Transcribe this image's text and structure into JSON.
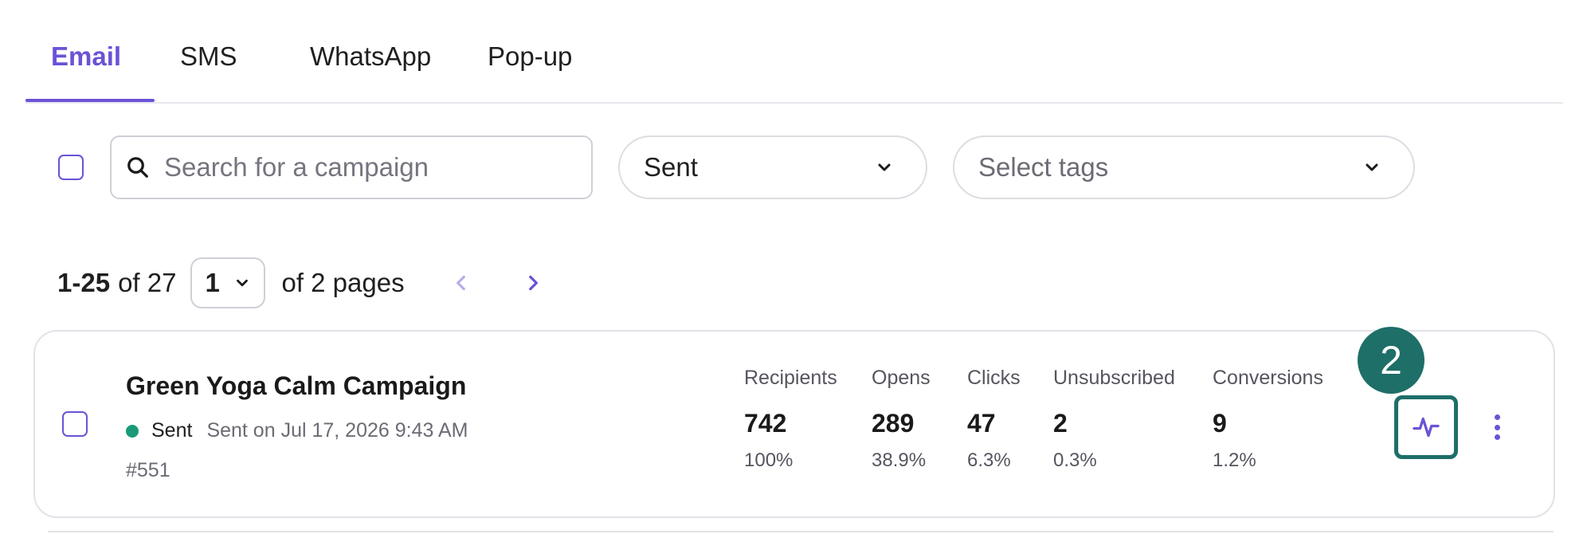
{
  "tabs": [
    {
      "label": "Email",
      "active": true
    },
    {
      "label": "SMS",
      "active": false
    },
    {
      "label": "WhatsApp",
      "active": false
    },
    {
      "label": "Pop-up",
      "active": false
    }
  ],
  "filters": {
    "search_placeholder": "Search for a campaign",
    "status_value": "Sent",
    "tags_placeholder": "Select tags"
  },
  "pagination": {
    "range": "1-25",
    "total_text": "of 27",
    "current_page": "1",
    "pages_text": "of 2 pages"
  },
  "campaign": {
    "title": "Green Yoga Calm Campaign",
    "status": "Sent",
    "sent_on": "Sent on Jul 17, 2026 9:43 AM",
    "id": "#551",
    "metrics": [
      {
        "label": "Recipients",
        "value": "742",
        "pct": "100%"
      },
      {
        "label": "Opens",
        "value": "289",
        "pct": "38.9%"
      },
      {
        "label": "Clicks",
        "value": "47",
        "pct": "6.3%"
      },
      {
        "label": "Unsubscribed",
        "value": "2",
        "pct": "0.3%"
      },
      {
        "label": "Conversions",
        "value": "9",
        "pct": "1.2%"
      }
    ],
    "step_badge": "2"
  },
  "colors": {
    "accent": "#6c52d6",
    "highlight": "#1e6f68",
    "status_sent": "#1a9a78"
  },
  "icons": [
    "search-icon",
    "chevron-down-icon",
    "chevron-left-icon",
    "chevron-right-icon",
    "activity-report-icon",
    "more-vertical-icon"
  ]
}
